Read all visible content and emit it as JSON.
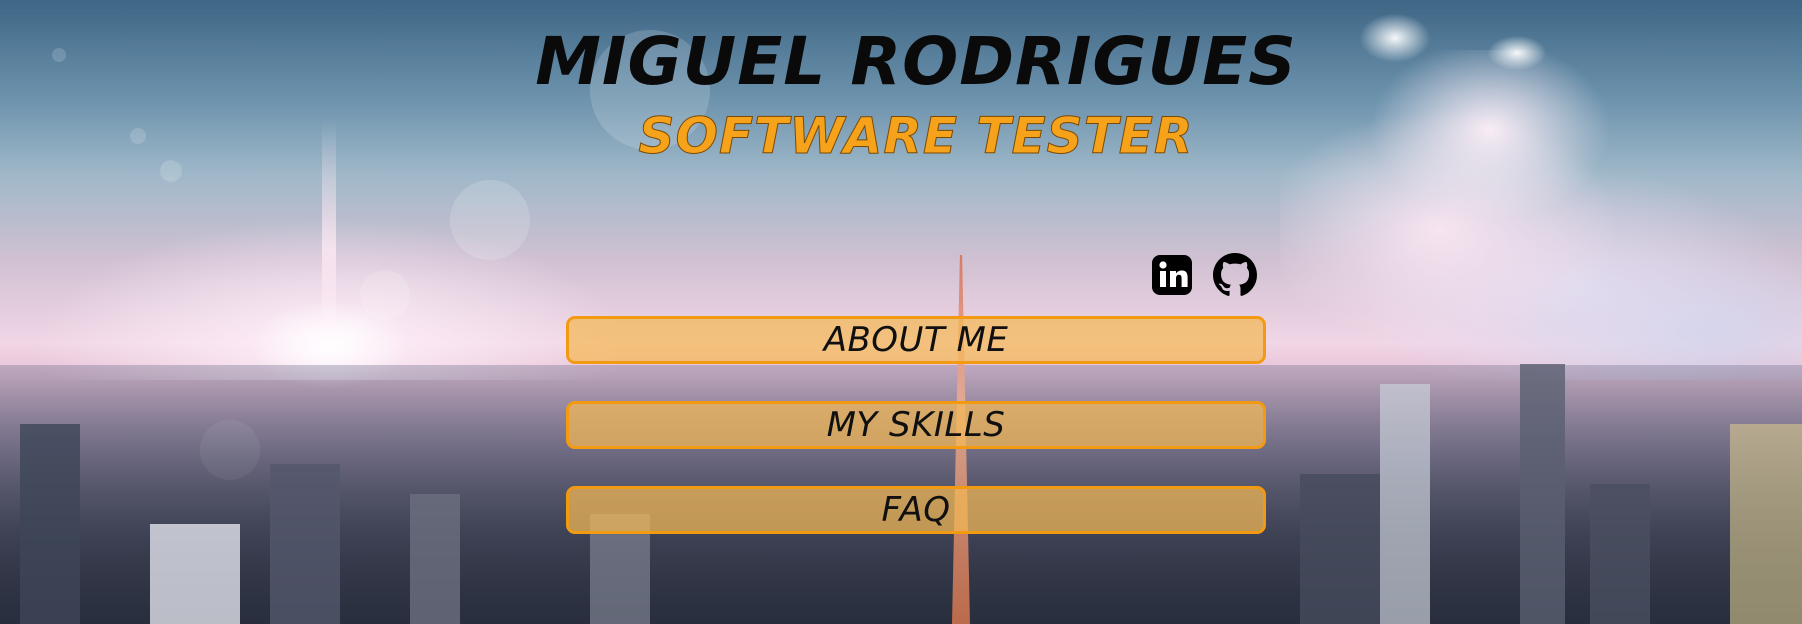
{
  "header": {
    "name": "MIGUEL RODRIGUES",
    "role": "SOFTWARE TESTER"
  },
  "social": {
    "linkedin_icon": "linkedin-icon",
    "github_icon": "github-icon"
  },
  "nav": {
    "items": [
      {
        "label": "ABOUT ME"
      },
      {
        "label": "MY SKILLS"
      },
      {
        "label": "FAQ"
      }
    ]
  },
  "colors": {
    "accent": "#f29b12",
    "button_fill": "#f4b854",
    "title": "#0a0a0a",
    "subtitle": "#f6a21a"
  }
}
